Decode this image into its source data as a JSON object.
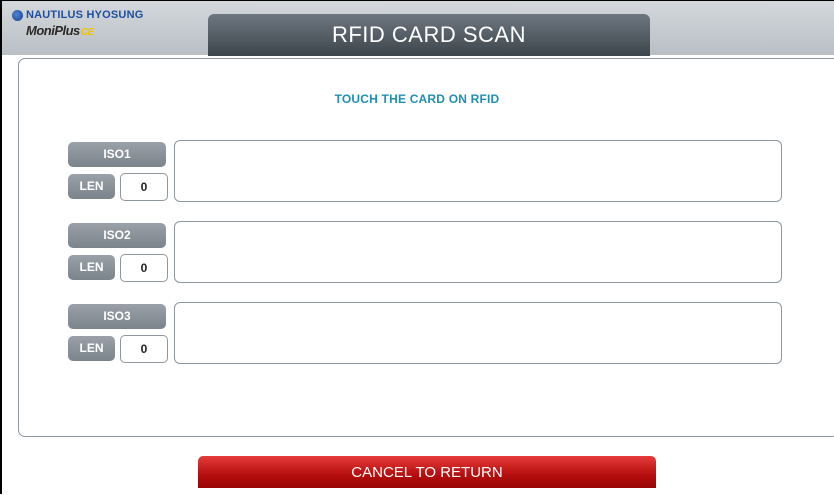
{
  "header": {
    "brand": "NAUTILUS HYOSUNG",
    "product": "MoniPlus",
    "product_suffix": "CE",
    "title": "RFID CARD SCAN"
  },
  "main": {
    "instruction": "TOUCH THE CARD ON RFID",
    "tracks": [
      {
        "label": "ISO1",
        "len_label": "LEN",
        "len_value": "0",
        "data": ""
      },
      {
        "label": "ISO2",
        "len_label": "LEN",
        "len_value": "0",
        "data": ""
      },
      {
        "label": "ISO3",
        "len_label": "LEN",
        "len_value": "0",
        "data": ""
      }
    ]
  },
  "footer": {
    "cancel_label": "CANCEL TO RETURN"
  },
  "colors": {
    "accent_instruction": "#1f8fb3",
    "cancel_button": "#c01515",
    "title_tab": "#4d555c"
  }
}
